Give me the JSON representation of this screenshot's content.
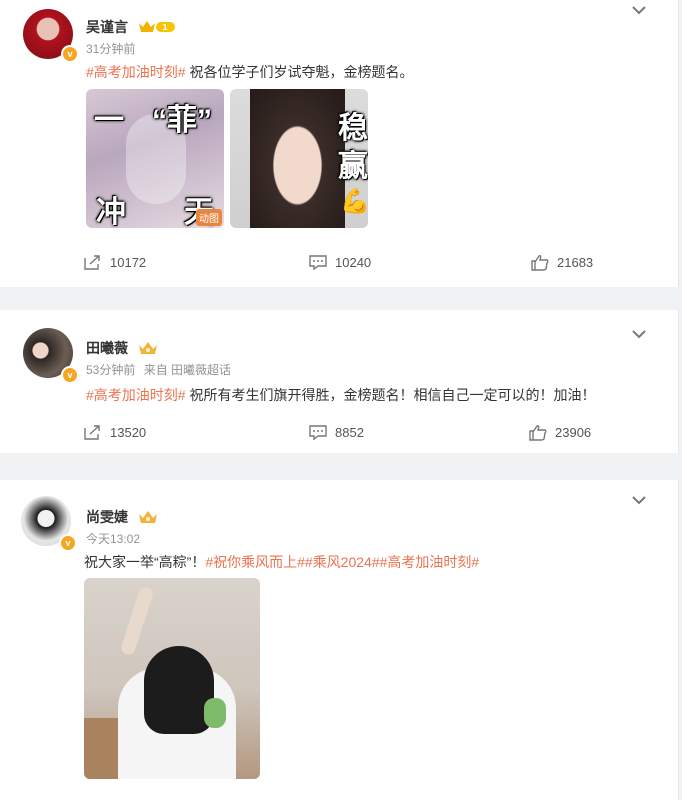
{
  "posts": [
    {
      "author": "吴谨言",
      "time": "31分钟前",
      "source": "",
      "text_prefix": "",
      "topic": "#高考加油时刻#",
      "text": "祝各位学子们岁试夺魁，金榜题名。",
      "images": [
        {
          "overlay_top": "一",
          "overlay_top2": "“菲”",
          "overlay_bottom_left": "冲",
          "overlay_bottom_right": "天",
          "tag": "动图"
        },
        {
          "overlay_1": "稳",
          "overlay_2": "赢"
        }
      ],
      "stats": {
        "forward": "10172",
        "comment": "10240",
        "like": "21683"
      }
    },
    {
      "author": "田曦薇",
      "time": "53分钟前",
      "source": "来自 田曦薇超话",
      "topic": "#高考加油时刻#",
      "text": "祝所有考生们旗开得胜，金榜题名！相信自己一定可以的！加油！",
      "stats": {
        "forward": "13520",
        "comment": "8852",
        "like": "23906"
      }
    },
    {
      "author": "尚雯婕",
      "time": "今天13:02",
      "text_prefix": "祝大家一举“高粽”！",
      "topics": "#祝你乘风而上##乘风2024##高考加油时刻#"
    }
  ],
  "colors": {
    "topic": "#eb7350",
    "badge": "#f5a623",
    "muted": "#939393"
  },
  "icons": [
    "forward-icon",
    "comment-icon",
    "like-icon",
    "chevron-down-icon",
    "crown-icon"
  ]
}
